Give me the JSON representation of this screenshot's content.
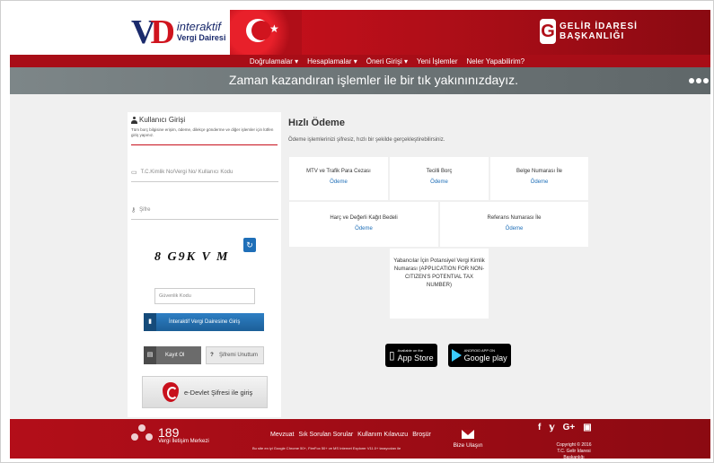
{
  "header": {
    "logo_mark_1": "V",
    "logo_mark_2": "D",
    "logo_line1": "interaktif",
    "logo_line2": "Vergi Dairesi",
    "agency_line1": "GELİR İDARESİ",
    "agency_line2": "BAŞKANLIĞI",
    "agency_icon": "G"
  },
  "nav": {
    "items": [
      "Doğrulamalar ▾",
      "Hesaplamalar ▾",
      "Öneri Girişi ▾",
      "Yeni İşlemler",
      "Neler Yapabilirim?"
    ]
  },
  "banner": {
    "text": "Zaman kazandıran işlemler ile bir tık yakınınızdayız."
  },
  "login": {
    "title": "Kullanıcı Girişi",
    "description": "Tüm borç bilgisine erişim, ödeme, dilekçe gönderme ve diğer işlemler için lütfen giriş yapınız.",
    "tc_placeholder": "T.C.Kimlik No/Vergi No/ Kullanıcı Kodu",
    "password_placeholder": "Şifre",
    "captcha_text": "8 G9K V M",
    "security_code_placeholder": "Güvenlik Kodu",
    "login_button": "İnteraktif Vergi Dairesine Giriş",
    "register_button": "Kayıt Ol",
    "forgot_button": "Şifremi Unuttum",
    "edevlet_button": "e-Devlet Şifresi ile giriş"
  },
  "quick_payment": {
    "title": "Hızlı Ödeme",
    "description": "Ödeme işlemlerinizi şifresiz, hızlı bir şekilde gerçekleştirebilirsiniz.",
    "cards": [
      {
        "label": "MTV ve Trafik Para Cezası",
        "link": "Ödeme"
      },
      {
        "label": "Tecilli Borç",
        "link": "Ödeme"
      },
      {
        "label": "Belge Numarası İle",
        "link": "Ödeme"
      },
      {
        "label": "Harç ve Değerli Kağıt Bedeli",
        "link": "Ödeme"
      },
      {
        "label": "Referans Numarası İle",
        "link": "Ödeme"
      },
      {
        "label": "Yabancılar İçin Potansiyel Vergi Kimlik Numarası (APPLICATION FOR NON-CITIZEN'S POTENTIAL TAX NUMBER)"
      }
    ]
  },
  "stores": {
    "appstore_small": "Available on the",
    "appstore_big": "App Store",
    "play_small": "ANDROID APP ON",
    "play_big": "Google play"
  },
  "footer": {
    "callcenter_number": "189",
    "callcenter_label": "Vergi İletişim Merkezi",
    "links": [
      "Mevzuat",
      "Sık Sorulan Sorular",
      "Kullanım Kılavuzu",
      "Broşür"
    ],
    "note": "Bu site en iyi Google Chrome 50+, FireFox 50+ ve MS Internet Explorer V11.0+ tarayıcıları ile",
    "contact": "Bize Ulaşın",
    "social": [
      "f",
      "𝕪",
      "G+",
      "▣"
    ],
    "copyright_1": "Copyright © 2016",
    "copyright_2": "T.C. Gelir İdaresi Başkanlığı"
  }
}
